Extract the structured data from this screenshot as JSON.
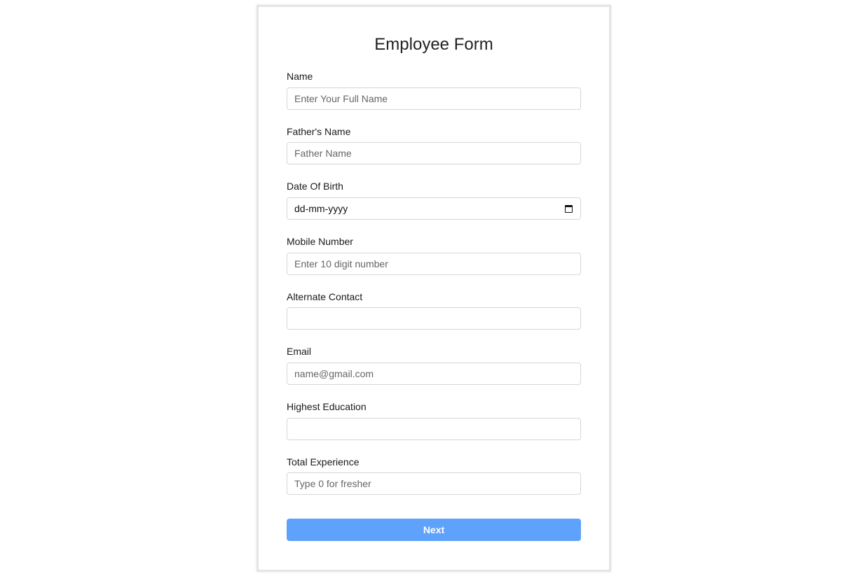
{
  "form": {
    "title": "Employee Form",
    "fields": {
      "name": {
        "label": "Name",
        "placeholder": "Enter Your Full Name",
        "value": ""
      },
      "father_name": {
        "label": "Father's Name",
        "placeholder": "Father Name",
        "value": ""
      },
      "dob": {
        "label": "Date Of Birth",
        "display": "dd-mm-yyyy",
        "icon": "calendar-icon"
      },
      "mobile": {
        "label": "Mobile Number",
        "placeholder": "Enter 10 digit number",
        "value": ""
      },
      "alternate_contact": {
        "label": "Alternate Contact",
        "placeholder": "",
        "value": ""
      },
      "email": {
        "label": "Email",
        "placeholder": "name@gmail.com",
        "value": ""
      },
      "education": {
        "label": "Highest Education",
        "placeholder": "",
        "value": ""
      },
      "experience": {
        "label": "Total Experience",
        "placeholder": "Type 0 for fresher",
        "value": ""
      }
    },
    "next_label": "Next",
    "colors": {
      "button": "#5fa2fb",
      "border": "#d6d6d6",
      "card_border": "#e5e5e5"
    }
  }
}
